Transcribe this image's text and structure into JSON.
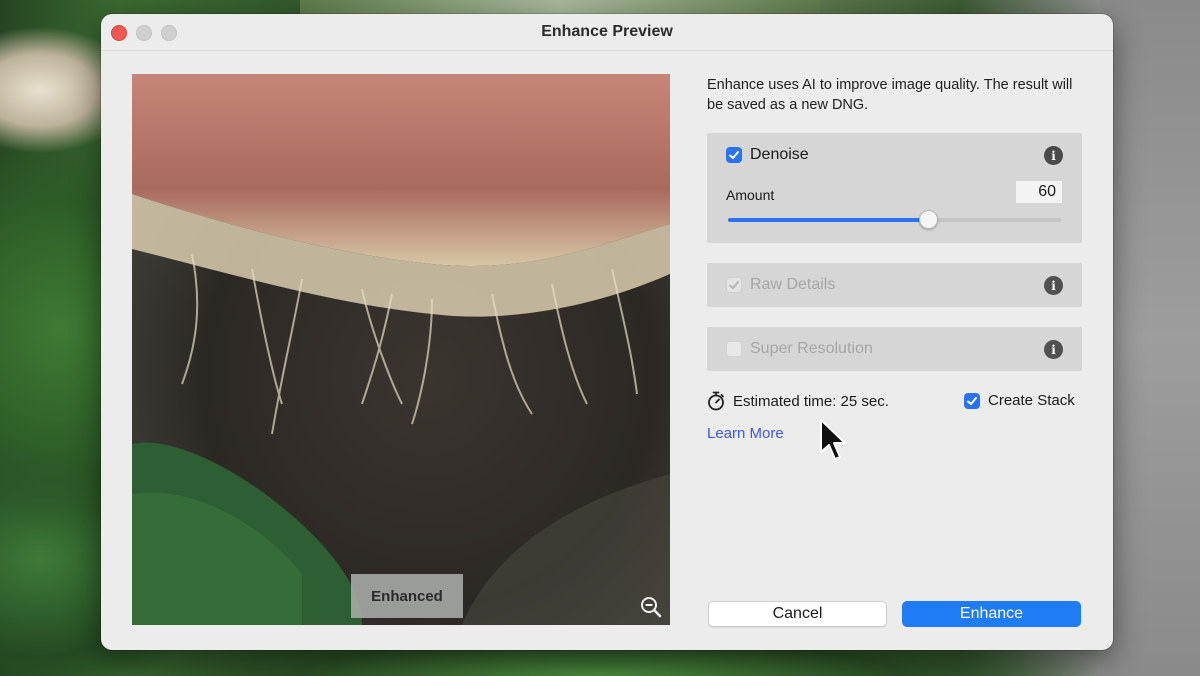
{
  "window": {
    "title": "Enhance Preview"
  },
  "preview": {
    "label": "Enhanced"
  },
  "description": "Enhance uses AI to improve image quality. The result will be saved as a new DNG.",
  "options": {
    "denoise": {
      "label": "Denoise",
      "checked": true,
      "amount_label": "Amount",
      "amount_value": "60",
      "amount_fraction": 0.6
    },
    "raw_details": {
      "label": "Raw Details",
      "checked": true,
      "enabled": false
    },
    "super_resolution": {
      "label": "Super Resolution",
      "checked": false,
      "enabled": false
    }
  },
  "estimate": {
    "text": "Estimated time: 25 sec."
  },
  "create_stack": {
    "label": "Create Stack",
    "checked": true
  },
  "learn_more": "Learn More",
  "buttons": {
    "cancel": "Cancel",
    "enhance": "Enhance"
  },
  "colors": {
    "accent": "#2a73f0",
    "link": "#3d5ad6",
    "enhance_button": "#1f7cf5"
  }
}
